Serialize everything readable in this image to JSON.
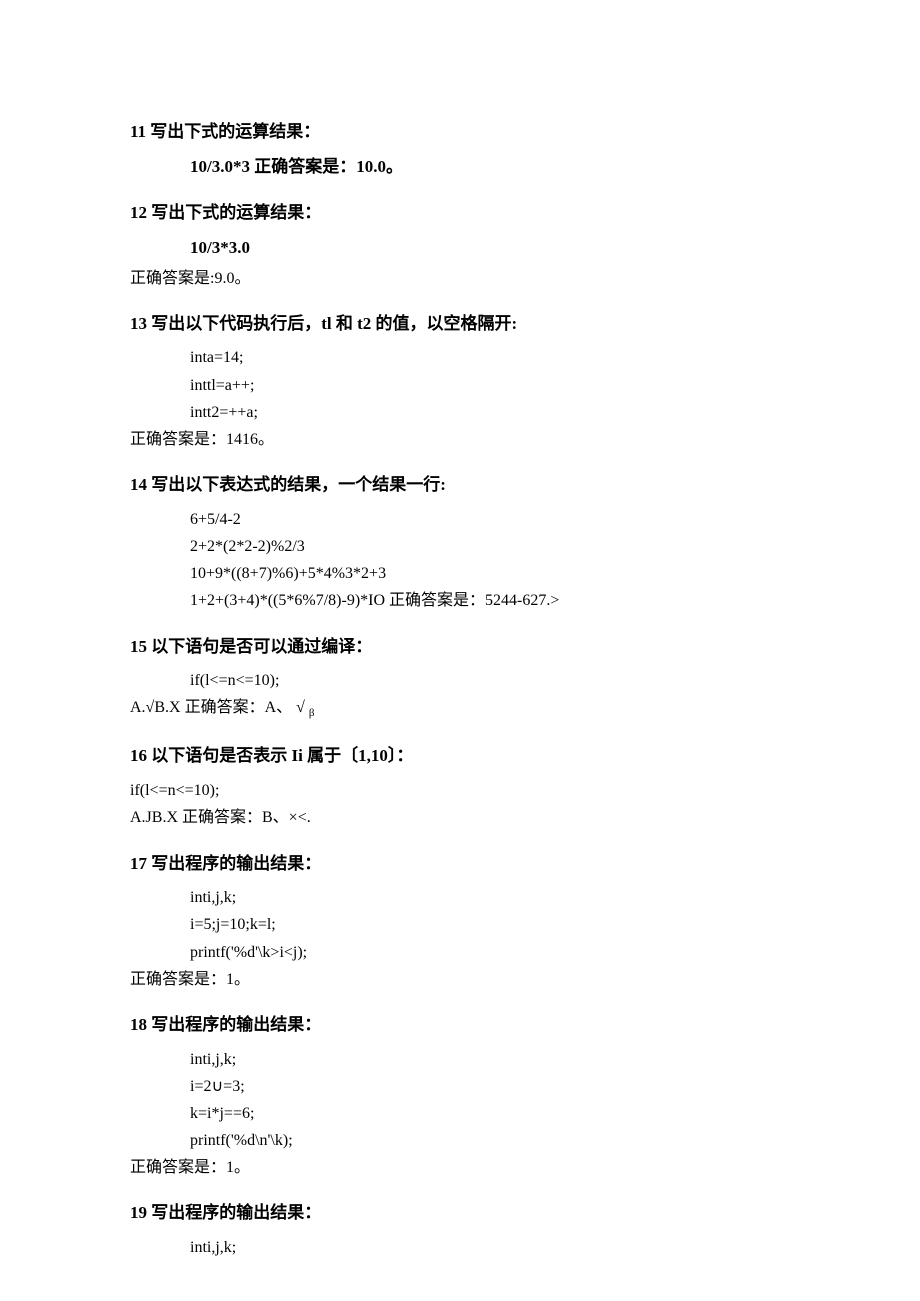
{
  "q11": {
    "heading": "11 写出下式的运算结果：",
    "content": "10/3.0*3 正确答案是：10.0。"
  },
  "q12": {
    "heading": "12 写出下式的运算结果：",
    "expr": "10/3*3.0",
    "answer": "正确答案是:9.0。"
  },
  "q13": {
    "heading": "13 写出以下代码执行后，tl 和 t2 的值，以空格隔开:",
    "lines": [
      "inta=14;",
      "inttl=a++;",
      "intt2=++a;"
    ],
    "answer": "正确答案是：1416。"
  },
  "q14": {
    "heading": "14 写出以下表达式的结果，一个结果一行:",
    "lines": [
      "6+5/4-2",
      "2+2*(2*2-2)%2/3",
      "10+9*((8+7)%6)+5*4%3*2+3",
      "1+2+(3+4)*((5*6%7/8)-9)*IO 正确答案是：5244-627.>"
    ]
  },
  "q15": {
    "heading": "15 以下语句是否可以通过编译：",
    "line1": "if(l<=n<=10);",
    "answer_prefix": "A.√B.X 正确答案：A、 √ ",
    "answer_sub": "β"
  },
  "q16": {
    "heading": "16 以下语句是否表示 Ii 属于〔1,10〕：",
    "line1": "if(l<=n<=10);",
    "answer": "A.JB.X 正确答案：B、×<."
  },
  "q17": {
    "heading": "17 写出程序的输出结果：",
    "lines": [
      "inti,j,k;",
      "i=5;j=10;k=l;",
      "printf('%d'\\k>i<j);"
    ],
    "answer": "正确答案是：1。"
  },
  "q18": {
    "heading": "18 写出程序的输出结果：",
    "lines": [
      "inti,j,k;",
      "i=2∪=3;",
      "k=i*j==6;",
      "printf('%d\\n'\\k);"
    ],
    "answer": "正确答案是：1。"
  },
  "q19": {
    "heading": "19 写出程序的输出结果：",
    "lines": [
      "inti,j,k;"
    ]
  }
}
